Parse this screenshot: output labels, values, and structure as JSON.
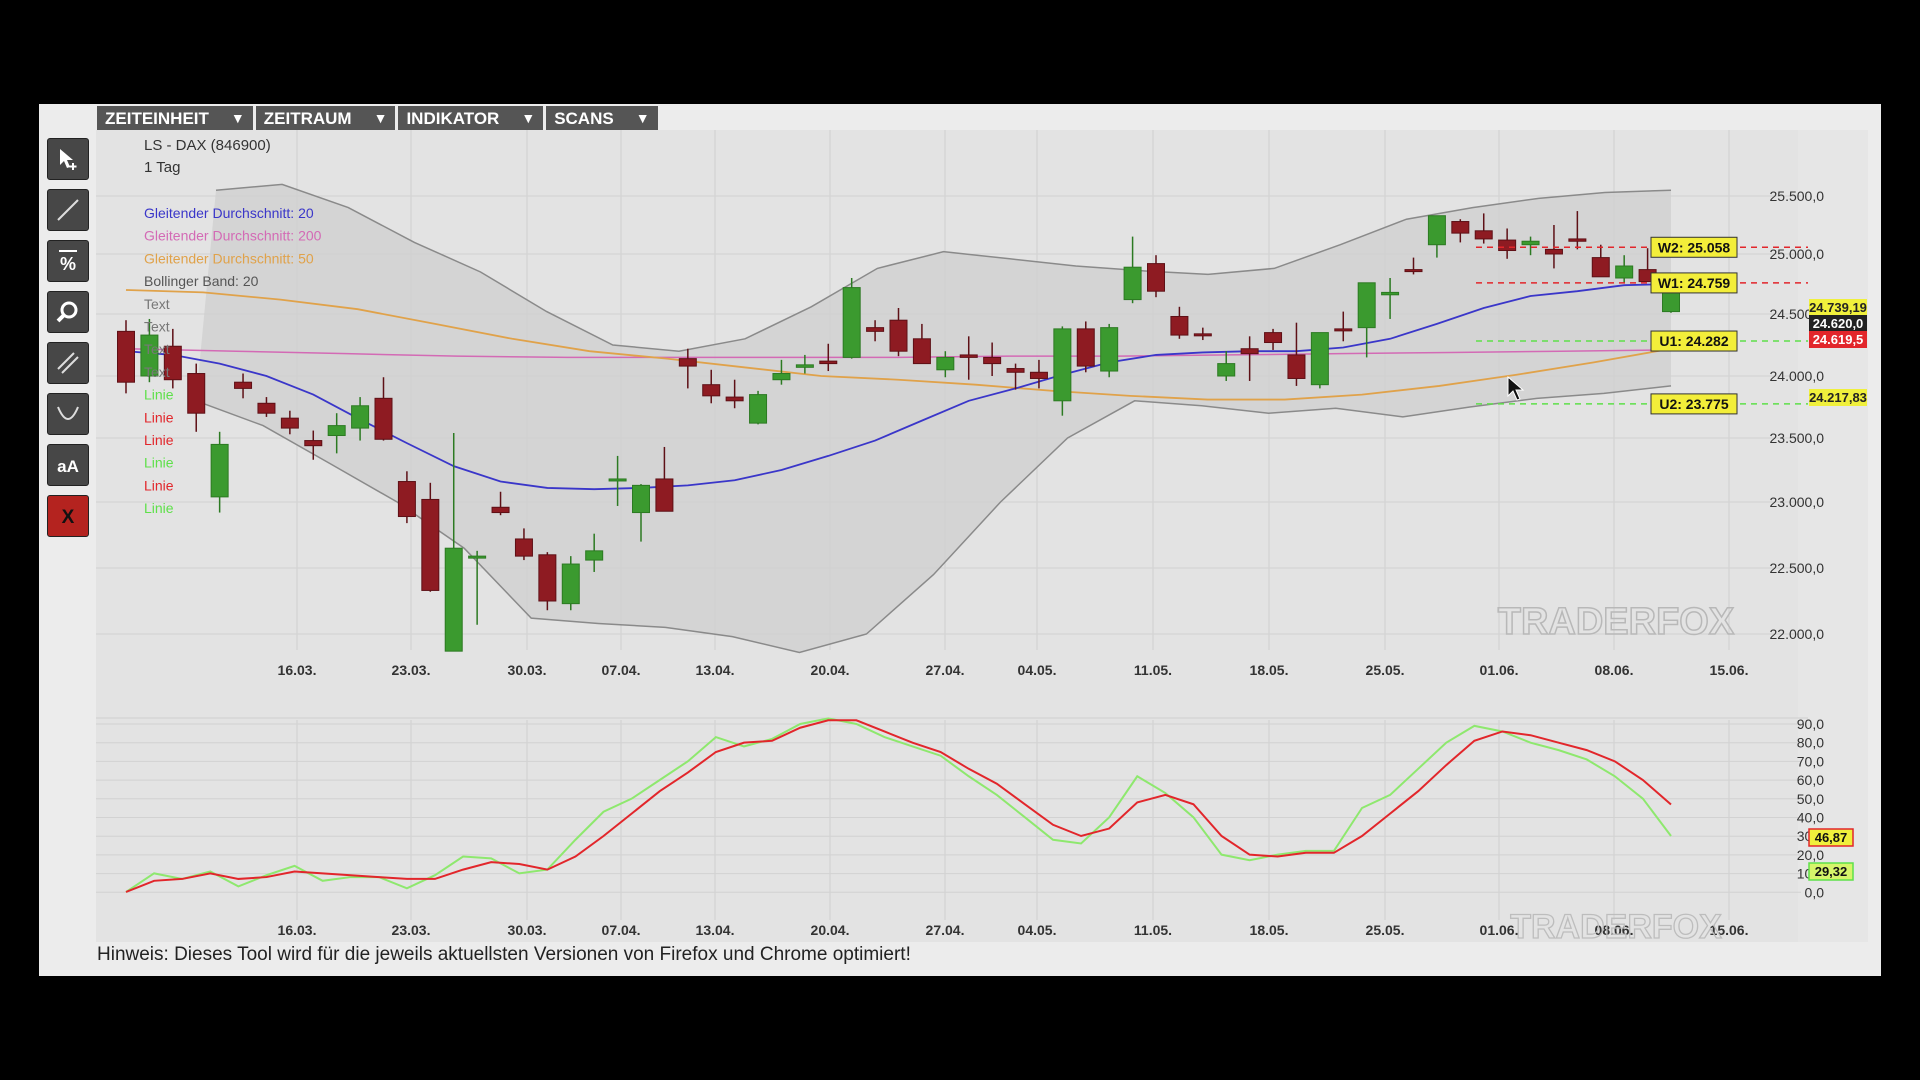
{
  "menu": [
    {
      "label": "ZEITEINHEIT",
      "arrow": "▼"
    },
    {
      "label": "ZEITRAUM",
      "arrow": "▼"
    },
    {
      "label": "INDIKATOR",
      "arrow": "▼"
    },
    {
      "label": "SCANS",
      "arrow": "▼"
    }
  ],
  "toolbar": {
    "tools": [
      {
        "name": "cursor-tool-icon"
      },
      {
        "name": "line-tool-icon"
      },
      {
        "name": "percent-tool-icon"
      },
      {
        "name": "zoom-tool-icon"
      },
      {
        "name": "parallel-lines-tool-icon"
      },
      {
        "name": "curve-tool-icon"
      },
      {
        "name": "text-tool-icon",
        "text": "aA"
      },
      {
        "name": "delete-tool-icon",
        "text": "X"
      }
    ]
  },
  "legend": {
    "title": "LS - DAX (846900)",
    "timeframe": "1 Tag",
    "items": [
      {
        "text": "Gleitender Durchschnitt: 20",
        "color": "#3a36c9"
      },
      {
        "text": "Gleitender Durchschnitt: 200",
        "color": "#d36ab5"
      },
      {
        "text": "Gleitender Durchschnitt: 50",
        "color": "#e0a24a"
      },
      {
        "text": "Bollinger Band: 20",
        "color": "#555555"
      },
      {
        "text": "Text",
        "color": "#777777"
      },
      {
        "text": "Text",
        "color": "#777777"
      },
      {
        "text": "Text",
        "color": "#777777"
      },
      {
        "text": "Text",
        "color": "#777777"
      },
      {
        "text": "Linie",
        "color": "#5ee04a"
      },
      {
        "text": "Linie",
        "color": "#e2262b"
      },
      {
        "text": "Linie",
        "color": "#e2262b"
      },
      {
        "text": "Linie",
        "color": "#5ee04a"
      },
      {
        "text": "Linie",
        "color": "#e2262b"
      },
      {
        "text": "Linie",
        "color": "#5ee04a"
      }
    ]
  },
  "price_axis": [
    "25.500,0",
    "25.000,0",
    "24.500,0",
    "24.000,0",
    "23.500,0",
    "23.000,0",
    "22.500,0",
    "22.000,0"
  ],
  "date_axis": [
    "16.03.",
    "23.03.",
    "30.03.",
    "07.04.",
    "13.04.",
    "20.04.",
    "27.04.",
    "04.05.",
    "11.05.",
    "18.05.",
    "25.05.",
    "01.06.",
    "08.06.",
    "15.06."
  ],
  "level_labels": [
    {
      "text": "W2: 25.058",
      "value": 25058,
      "color": "#e2262b"
    },
    {
      "text": "W1: 24.759",
      "value": 24759,
      "color": "#e2262b"
    },
    {
      "text": "U1: 24.282",
      "value": 24282,
      "color": "#5ee04a"
    },
    {
      "text": "U2: 23.775",
      "value": 23775,
      "color": "#5ee04a"
    }
  ],
  "right_tags": [
    {
      "text": "24.739,19",
      "bg": "#f0f03c",
      "fg": "#222"
    },
    {
      "text": "24.620,0",
      "bg": "#222222",
      "fg": "#ffffff"
    },
    {
      "text": "24.619,5",
      "bg": "#e2262b",
      "fg": "#ffffff"
    },
    {
      "text": "24.217,83",
      "bg": "#f0f03c",
      "fg": "#222"
    }
  ],
  "osc_axis": [
    "90,0",
    "80,0",
    "70,0",
    "60,0",
    "50,0",
    "40,0",
    "30,0",
    "20,0",
    "10,0",
    "0,0"
  ],
  "osc_tags": [
    {
      "text": "46,87",
      "bg": "#f0f03c",
      "border": "#e2262b",
      "value": 46.87
    },
    {
      "text": "29,32",
      "bg": "#d6f56a",
      "border": "#5ee04a",
      "value": 29.32
    }
  ],
  "watermark": "TRADERFOX",
  "hint": "Hinweis: Dieses Tool wird für die jeweils aktuellsten Versionen von Firefox und Chrome optimiert!",
  "colors": {
    "up": "#3b9a2f",
    "down": "#8e1b22",
    "ma20": "#3a36c9",
    "ma200": "#d36ab5",
    "ma50": "#e0a24a",
    "band": "#888888",
    "stoch_k": "#8ee86e",
    "stoch_d": "#e2262b"
  },
  "chart_data": {
    "type": "candlestick",
    "candles": [
      [
        24360,
        24450,
        23860,
        23950
      ],
      [
        24000,
        24460,
        23950,
        24330
      ],
      [
        24240,
        24380,
        23900,
        23970
      ],
      [
        24020,
        24100,
        23550,
        23700
      ],
      [
        23040,
        23550,
        22920,
        23450
      ],
      [
        23950,
        24020,
        23820,
        23900
      ],
      [
        23780,
        23830,
        23670,
        23700
      ],
      [
        23660,
        23720,
        23530,
        23580
      ],
      [
        23480,
        23560,
        23330,
        23440
      ],
      [
        23520,
        23700,
        23380,
        23600
      ],
      [
        23580,
        23830,
        23480,
        23760
      ],
      [
        23820,
        23990,
        23480,
        23490
      ],
      [
        23160,
        23240,
        22840,
        22890
      ],
      [
        23020,
        23150,
        22320,
        22330
      ],
      [
        21870,
        23540,
        21870,
        22650
      ],
      [
        22590,
        22630,
        22070,
        22590
      ],
      [
        22960,
        23080,
        22900,
        22920
      ],
      [
        22720,
        22800,
        22560,
        22590
      ],
      [
        22600,
        22620,
        22180,
        22250
      ],
      [
        22230,
        22590,
        22180,
        22530
      ],
      [
        22560,
        22760,
        22470,
        22630
      ],
      [
        23180,
        23360,
        22970,
        23180
      ],
      [
        22920,
        23140,
        22700,
        23130
      ],
      [
        23180,
        23430,
        22930,
        22930
      ],
      [
        24140,
        24220,
        23900,
        24080
      ],
      [
        23930,
        24050,
        23780,
        23840
      ],
      [
        23830,
        23970,
        23740,
        23800
      ],
      [
        23620,
        23880,
        23610,
        23850
      ],
      [
        23970,
        24130,
        23930,
        24020
      ],
      [
        24070,
        24170,
        24020,
        24090
      ],
      [
        24120,
        24260,
        24040,
        24100
      ],
      [
        24150,
        24800,
        24140,
        24720
      ],
      [
        24390,
        24450,
        24280,
        24360
      ],
      [
        24450,
        24550,
        24160,
        24200
      ],
      [
        24300,
        24420,
        24100,
        24100
      ],
      [
        24050,
        24200,
        23990,
        24150
      ],
      [
        24170,
        24320,
        23970,
        24150
      ],
      [
        24150,
        24270,
        24000,
        24100
      ],
      [
        24060,
        24100,
        23890,
        24030
      ],
      [
        24030,
        24130,
        23900,
        23980
      ],
      [
        23800,
        24400,
        23680,
        24380
      ],
      [
        24380,
        24440,
        24030,
        24080
      ],
      [
        24040,
        24420,
        23990,
        24390
      ],
      [
        24620,
        25150,
        24590,
        24890
      ],
      [
        24920,
        24990,
        24640,
        24690
      ],
      [
        24480,
        24560,
        24300,
        24330
      ],
      [
        24340,
        24390,
        24290,
        24330
      ],
      [
        24000,
        24200,
        23960,
        24100
      ],
      [
        24220,
        24320,
        23960,
        24180
      ],
      [
        24350,
        24380,
        24210,
        24270
      ],
      [
        24170,
        24430,
        23920,
        23980
      ],
      [
        23930,
        24300,
        23900,
        24350
      ],
      [
        24380,
        24520,
        24280,
        24370
      ],
      [
        24390,
        24730,
        24150,
        24760
      ],
      [
        24660,
        24800,
        24460,
        24680
      ],
      [
        24870,
        24970,
        24830,
        24860
      ],
      [
        25080,
        25310,
        24970,
        25330
      ],
      [
        25280,
        25300,
        25100,
        25180
      ],
      [
        25200,
        25350,
        25090,
        25130
      ],
      [
        25120,
        25220,
        24960,
        25030
      ],
      [
        25080,
        25150,
        24990,
        25110
      ],
      [
        25040,
        25250,
        24880,
        25000
      ],
      [
        25130,
        25370,
        25040,
        25110
      ],
      [
        24970,
        25080,
        24820,
        24810
      ],
      [
        24800,
        24990,
        24760,
        24900
      ],
      [
        24870,
        25050,
        24820,
        24770
      ],
      [
        24520,
        24760,
        24510,
        24730
      ]
    ],
    "xlim": [
      0,
      71
    ],
    "ylim": [
      21700,
      25850
    ],
    "stoch_k": [
      0,
      10,
      7,
      11,
      3,
      9,
      14,
      6,
      8,
      8,
      2,
      9,
      19,
      18,
      10,
      12,
      28,
      43,
      50,
      60,
      70,
      83,
      78,
      82,
      90,
      93,
      90,
      83,
      78,
      73,
      62,
      52,
      40,
      28,
      26,
      40,
      62,
      53,
      40,
      20,
      17,
      20,
      22,
      22,
      45,
      52,
      66,
      80,
      89,
      86,
      80,
      76,
      71,
      62,
      50,
      30
    ],
    "stoch_d": [
      0,
      6,
      7,
      10,
      7,
      8,
      11,
      10,
      9,
      8,
      7,
      7,
      12,
      16,
      15,
      12,
      19,
      30,
      42,
      54,
      64,
      75,
      80,
      81,
      88,
      92,
      92,
      86,
      80,
      75,
      66,
      58,
      47,
      36,
      30,
      34,
      48,
      52,
      47,
      30,
      20,
      19,
      21,
      21,
      30,
      42,
      54,
      68,
      81,
      86,
      84,
      80,
      76,
      70,
      60,
      46.87
    ],
    "ma20": [
      24200,
      24170,
      24100,
      24000,
      23850,
      23650,
      23460,
      23280,
      23160,
      23110,
      23100,
      23110,
      23130,
      23170,
      23250,
      23360,
      23480,
      23640,
      23800,
      23900,
      24010,
      24110,
      24170,
      24190,
      24200,
      24200,
      24230,
      24300,
      24420,
      24550,
      24650,
      24690,
      24740,
      24750
    ],
    "ma50": [
      24700,
      24680,
      24620,
      24540,
      24420,
      24300,
      24200,
      24140,
      24070,
      24000,
      23970,
      23930,
      23880,
      23840,
      23810,
      23810,
      23850,
      23920,
      24010,
      24110,
      24220
    ],
    "ma200": [
      24220,
      24200,
      24180,
      24160,
      24150,
      24150,
      24150,
      24150,
      24160,
      24160,
      24170,
      24180,
      24190,
      24200,
      24210
    ],
    "bb_upper": [
      25550,
      25600,
      25400,
      25100,
      24850,
      24520,
      24250,
      24200,
      24300,
      24560,
      24880,
      25020,
      24960,
      24900,
      24860,
      24830,
      24880,
      25080,
      25300,
      25400,
      25480,
      25530,
      25550
    ],
    "bb_lower": [
      23800,
      23600,
      23300,
      23000,
      22650,
      22120,
      22080,
      22050,
      21980,
      21860,
      22000,
      22450,
      23000,
      23500,
      23800,
      23760,
      23700,
      23740,
      23670,
      23750,
      23820,
      23860,
      23920
    ]
  }
}
